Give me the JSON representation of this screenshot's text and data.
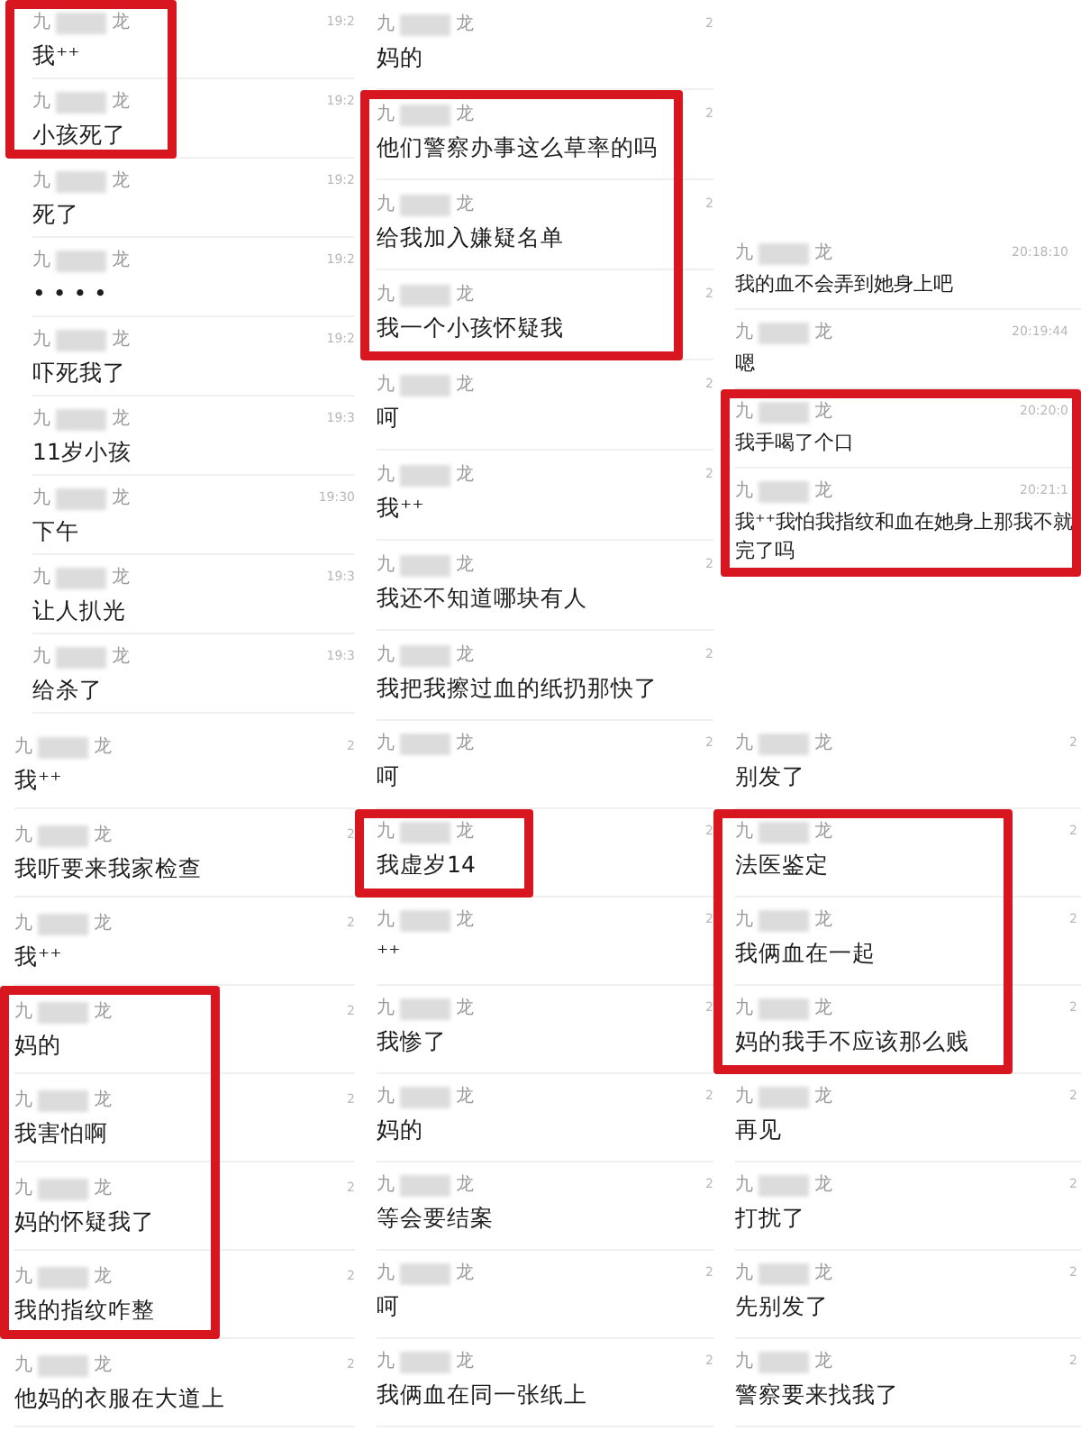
{
  "columns": [
    {
      "panels": [
        {
          "groups": [
            {
              "highlighted": true,
              "messages": [
                {
                  "name_start": "九",
                  "name_end": "龙",
                  "time": "19:2",
                  "text": "我⁺⁺"
                },
                {
                  "name_start": "九",
                  "name_end": "龙",
                  "time": "19:2",
                  "text": "小孩死了"
                }
              ]
            },
            {
              "highlighted": false,
              "messages": [
                {
                  "name_start": "九",
                  "name_end": "龙",
                  "time": "19:2",
                  "text": "死了"
                },
                {
                  "name_start": "九",
                  "name_end": "龙",
                  "time": "19:2",
                  "text": "• • • •"
                },
                {
                  "name_start": "九",
                  "name_end": "龙",
                  "time": "19:2",
                  "text": "吓死我了"
                },
                {
                  "name_start": "九",
                  "name_end": "龙",
                  "time": "19:3",
                  "text": "11岁小孩"
                },
                {
                  "name_start": "九",
                  "name_end": "龙",
                  "time": "19:30",
                  "text": "下午"
                },
                {
                  "name_start": "九",
                  "name_end": "龙",
                  "time": "19:3",
                  "text": "让人扒光"
                },
                {
                  "name_start": "九",
                  "name_end": "龙",
                  "time": "19:3",
                  "text": "给杀了"
                }
              ]
            }
          ]
        },
        {
          "groups": [
            {
              "highlighted": false,
              "messages": [
                {
                  "name_start": "九",
                  "name_end": "龙",
                  "time": "2",
                  "text": "我⁺⁺"
                },
                {
                  "name_start": "九",
                  "name_end": "龙",
                  "time": "2",
                  "text": "我听要来我家检查"
                },
                {
                  "name_start": "九",
                  "name_end": "龙",
                  "time": "2",
                  "text": "我⁺⁺"
                }
              ]
            },
            {
              "highlighted": true,
              "messages": [
                {
                  "name_start": "九",
                  "name_end": "龙",
                  "time": "2",
                  "text": "妈的"
                },
                {
                  "name_start": "九",
                  "name_end": "龙",
                  "time": "2",
                  "text": "我害怕啊"
                },
                {
                  "name_start": "九",
                  "name_end": "龙",
                  "time": "2",
                  "text": "妈的怀疑我了"
                },
                {
                  "name_start": "九",
                  "name_end": "龙",
                  "time": "2",
                  "text": "我的指纹咋整"
                }
              ]
            },
            {
              "highlighted": false,
              "messages": [
                {
                  "name_start": "九",
                  "name_end": "龙",
                  "time": "2",
                  "text": "他妈的衣服在大道上"
                }
              ]
            }
          ]
        }
      ]
    },
    {
      "panels": [
        {
          "groups": [
            {
              "highlighted": false,
              "messages": [
                {
                  "name_start": "九",
                  "name_end": "龙",
                  "time": "2",
                  "text": "妈的"
                }
              ]
            },
            {
              "highlighted": true,
              "messages": [
                {
                  "name_start": "九",
                  "name_end": "龙",
                  "time": "2",
                  "text": "他们警察办事这么草率的吗"
                },
                {
                  "name_start": "九",
                  "name_end": "龙",
                  "time": "2",
                  "text": "给我加入嫌疑名单"
                },
                {
                  "name_start": "九",
                  "name_end": "龙",
                  "time": "2",
                  "text": "我一个小孩怀疑我"
                }
              ]
            },
            {
              "highlighted": false,
              "messages": [
                {
                  "name_start": "九",
                  "name_end": "龙",
                  "time": "2",
                  "text": "呵"
                },
                {
                  "name_start": "九",
                  "name_end": "龙",
                  "time": "2",
                  "text": "我⁺⁺"
                },
                {
                  "name_start": "九",
                  "name_end": "龙",
                  "time": "2",
                  "text": "我还不知道哪块有人"
                },
                {
                  "name_start": "九",
                  "name_end": "龙",
                  "time": "2",
                  "text": "我把我擦过血的纸扔那快了"
                }
              ]
            }
          ]
        },
        {
          "groups": [
            {
              "highlighted": false,
              "messages": [
                {
                  "name_start": "九",
                  "name_end": "龙",
                  "time": "2",
                  "text": "呵"
                }
              ]
            },
            {
              "highlighted": true,
              "messages": [
                {
                  "name_start": "九",
                  "name_end": "龙",
                  "time": "2",
                  "text": "我虚岁14"
                }
              ]
            },
            {
              "highlighted": false,
              "messages": [
                {
                  "name_start": "九",
                  "name_end": "龙",
                  "time": "2",
                  "text": "⁺⁺"
                },
                {
                  "name_start": "九",
                  "name_end": "龙",
                  "time": "2",
                  "text": "我惨了"
                },
                {
                  "name_start": "九",
                  "name_end": "龙",
                  "time": "2",
                  "text": "妈的"
                },
                {
                  "name_start": "九",
                  "name_end": "龙",
                  "time": "2",
                  "text": "等会要结案"
                },
                {
                  "name_start": "九",
                  "name_end": "龙",
                  "time": "2",
                  "text": "呵"
                },
                {
                  "name_start": "九",
                  "name_end": "龙",
                  "time": "2",
                  "text": "我俩血在同一张纸上"
                }
              ]
            }
          ]
        }
      ]
    },
    {
      "panels": [
        {
          "groups": [
            {
              "highlighted": false,
              "messages": [
                {
                  "name_start": "九",
                  "name_end": "龙",
                  "time": "20:18:10",
                  "text": "我的血不会弄到她身上吧"
                },
                {
                  "name_start": "九",
                  "name_end": "龙",
                  "time": "20:19:44",
                  "text": "嗯"
                }
              ]
            },
            {
              "highlighted": true,
              "messages": [
                {
                  "name_start": "九",
                  "name_end": "龙",
                  "time": "20:20:0",
                  "text": "我手喝了个口"
                },
                {
                  "name_start": "九",
                  "name_end": "龙",
                  "time": "20:21:1",
                  "text": "我⁺⁺我怕我指纹和血在她身上那我不就完了吗"
                }
              ]
            }
          ]
        },
        {
          "groups": [
            {
              "highlighted": false,
              "messages": [
                {
                  "name_start": "九",
                  "name_end": "龙",
                  "time": "2",
                  "text": "别发了"
                }
              ]
            },
            {
              "highlighted": true,
              "messages": [
                {
                  "name_start": "九",
                  "name_end": "龙",
                  "time": "2",
                  "text": "法医鉴定"
                },
                {
                  "name_start": "九",
                  "name_end": "龙",
                  "time": "2",
                  "text": "我俩血在一起"
                },
                {
                  "name_start": "九",
                  "name_end": "龙",
                  "time": "2",
                  "text": "妈的我手不应该那么贱"
                }
              ]
            },
            {
              "highlighted": false,
              "messages": [
                {
                  "name_start": "九",
                  "name_end": "龙",
                  "time": "2",
                  "text": "再见"
                },
                {
                  "name_start": "九",
                  "name_end": "龙",
                  "time": "2",
                  "text": "打扰了"
                },
                {
                  "name_start": "九",
                  "name_end": "龙",
                  "time": "2",
                  "text": "先别发了"
                },
                {
                  "name_start": "九",
                  "name_end": "龙",
                  "time": "2",
                  "text": "警察要来找我了"
                }
              ]
            }
          ]
        }
      ]
    }
  ]
}
